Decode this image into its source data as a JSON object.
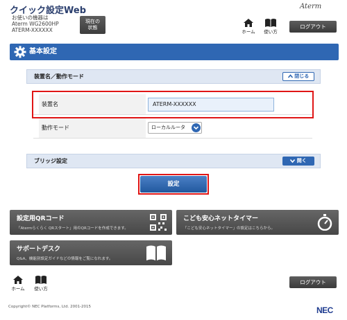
{
  "header": {
    "app_title": "クイック設定Web",
    "device_label": "お使いの機器は",
    "device_model": "Aterm WG2600HP",
    "device_name": "ATERM-XXXXXX",
    "status_button_line1": "現在の",
    "status_button_line2": "状態",
    "brand": "Aterm",
    "home_label": "ホーム",
    "help_label": "使い方",
    "logout_label": "ログアウト"
  },
  "page": {
    "section_title": "基本設定",
    "accordion1": {
      "title": "装置名／動作モード",
      "button": "閉じる"
    },
    "fields": {
      "device_name_label": "装置名",
      "device_name_value": "ATERM-XXXXXX",
      "mode_label": "動作モード",
      "mode_value": "ローカルルータ"
    },
    "accordion2": {
      "title": "ブリッジ設定",
      "button": "開く"
    },
    "set_button": "設定"
  },
  "tiles": {
    "qr": {
      "title": "設定用QRコード",
      "desc": "「Atermらくらく QRスタート」用のQRコードを作成できます。"
    },
    "kids": {
      "title": "こども安心ネットタイマー",
      "desc": "「こども安心ネットタイマー」の設定はこちらから。"
    },
    "support": {
      "title": "サポートデスク",
      "desc": "Q&A、機能別設定ガイドなどの情報をご覧になれます。"
    }
  },
  "footer": {
    "home_label": "ホーム",
    "help_label": "使い方",
    "logout_label": "ログアウト",
    "copyright": "Copyright© NEC Platforms, Ltd. 2001-2015",
    "nec_logo": "NEC"
  },
  "colors": {
    "accent_blue": "#2f67b3",
    "highlight_red": "#e01515",
    "tile_gray": "#555555"
  },
  "icons": [
    "home-icon",
    "book-icon",
    "gear-icon",
    "chevron-up-icon",
    "chevron-down-icon",
    "qr-code-icon",
    "stopwatch-icon"
  ]
}
